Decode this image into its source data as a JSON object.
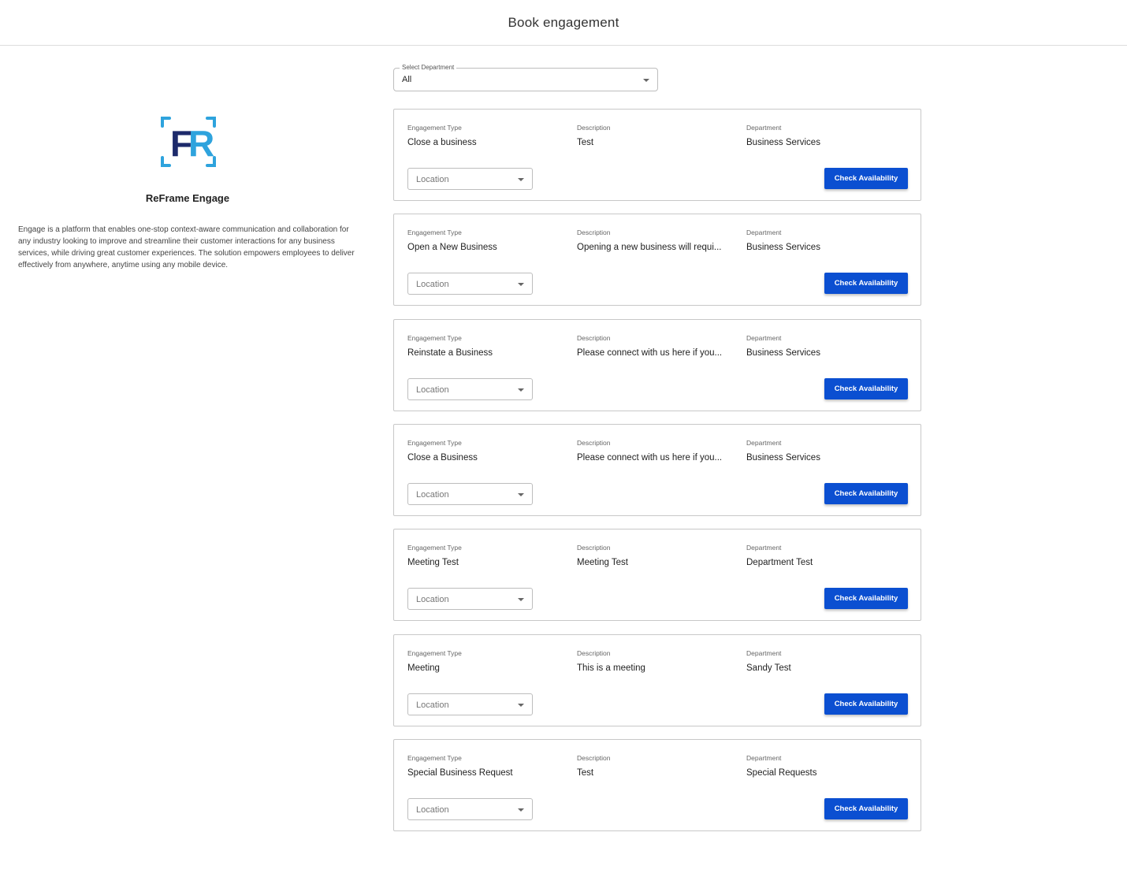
{
  "header": {
    "title": "Book engagement"
  },
  "brand": {
    "name": "ReFrame Engage",
    "logo_text": "FR",
    "logo_colors": {
      "f": "#1d2a6b",
      "r": "#2ea3dd",
      "brackets": "#2ea3dd"
    },
    "description": "Engage is a platform that enables one-stop context-aware communication and collaboration for any industry looking to improve and streamline their customer interactions for any business services, while driving great customer experiences. The solution empowers employees to deliver effectively from anywhere, anytime using any mobile device."
  },
  "department_select": {
    "label": "Select Department",
    "value": "All"
  },
  "labels": {
    "engagement_type": "Engagement Type",
    "description": "Description",
    "department": "Department",
    "location_placeholder": "Location",
    "check_button": "Check Availability"
  },
  "colors": {
    "button": "#0b4fd1",
    "card_border": "#c8c8c8"
  },
  "engagements": [
    {
      "type": "Close a business",
      "description": "Test",
      "department": "Business Services"
    },
    {
      "type": "Open a New Business",
      "description": "Opening a new business will requi...",
      "department": "Business Services"
    },
    {
      "type": "Reinstate a Business",
      "description": "Please connect with us here if you...",
      "department": "Business Services"
    },
    {
      "type": "Close a Business",
      "description": "Please connect with us here if you...",
      "department": "Business Services"
    },
    {
      "type": "Meeting Test",
      "description": "Meeting Test",
      "department": "Department Test"
    },
    {
      "type": "Meeting",
      "description": "This is a meeting",
      "department": "Sandy Test"
    },
    {
      "type": "Special Business Request",
      "description": "Test",
      "department": "Special Requests"
    }
  ]
}
